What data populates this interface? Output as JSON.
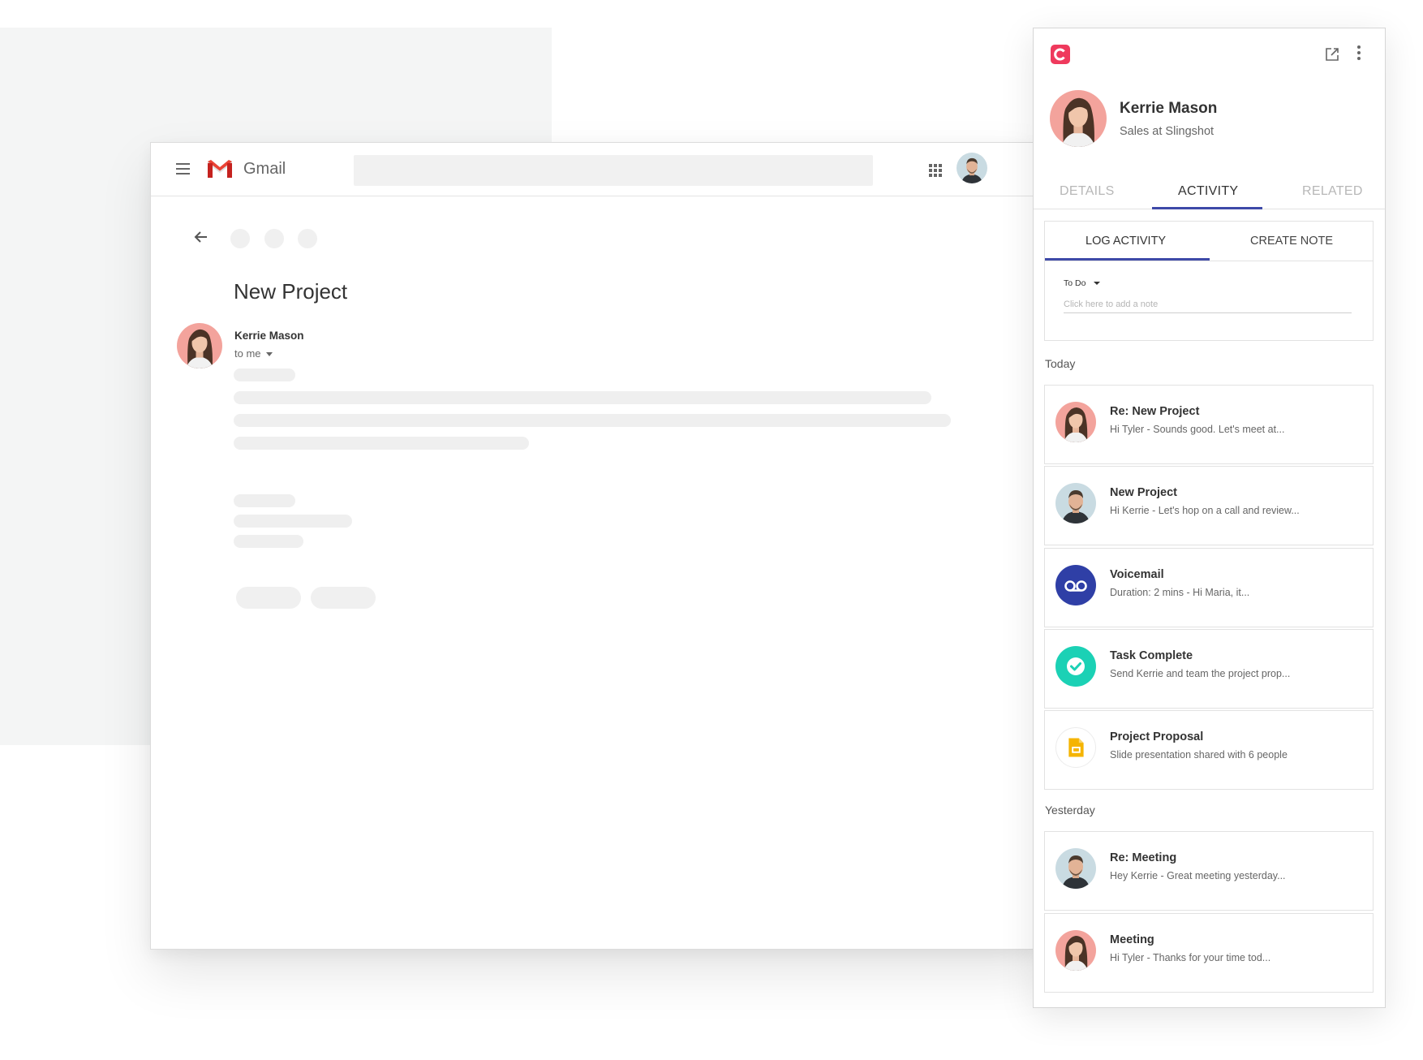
{
  "gmail": {
    "app_name": "Gmail",
    "email": {
      "subject": "New Project",
      "sender": "Kerrie Mason",
      "recipient_label": "to me"
    }
  },
  "panel": {
    "contact": {
      "name": "Kerrie Mason",
      "role": "Sales at Slingshot"
    },
    "tabs": [
      {
        "label": "DETAILS"
      },
      {
        "label": "ACTIVITY",
        "active": true
      },
      {
        "label": "RELATED"
      }
    ],
    "log": {
      "tabs": [
        {
          "label": "LOG ACTIVITY",
          "active": true
        },
        {
          "label": "CREATE NOTE"
        }
      ],
      "type_value": "To Do",
      "note_placeholder": "Click here to add a note"
    },
    "sections": [
      {
        "label": "Today",
        "items": [
          {
            "title": "Re: New Project",
            "preview": "Hi Tyler -  Sounds good. Let's meet at...",
            "icon": "avatar-woman"
          },
          {
            "title": "New Project",
            "preview": "Hi Kerrie - Let's hop on a call and review...",
            "icon": "avatar-man"
          },
          {
            "title": "Voicemail",
            "preview": "Duration: 2 mins -  Hi Maria, it...",
            "icon": "voicemail-icon"
          },
          {
            "title": "Task Complete",
            "preview": "Send Kerrie and team the project prop...",
            "icon": "check-icon"
          },
          {
            "title": "Project Proposal",
            "preview": "Slide presentation shared with 6 people",
            "icon": "slides-icon"
          }
        ]
      },
      {
        "label": "Yesterday",
        "items": [
          {
            "title": "Re: Meeting",
            "preview": "Hey Kerrie - Great meeting yesterday...",
            "icon": "avatar-man"
          },
          {
            "title": "Meeting",
            "preview": "Hi Tyler - Thanks for your time tod...",
            "icon": "avatar-woman"
          }
        ]
      }
    ]
  },
  "colors": {
    "accent": "#3e4aa8",
    "brand": "#ef3a5d",
    "voicemail": "#2f3fa6",
    "task_complete": "#1bd1b5",
    "slides": "#f5b400"
  }
}
